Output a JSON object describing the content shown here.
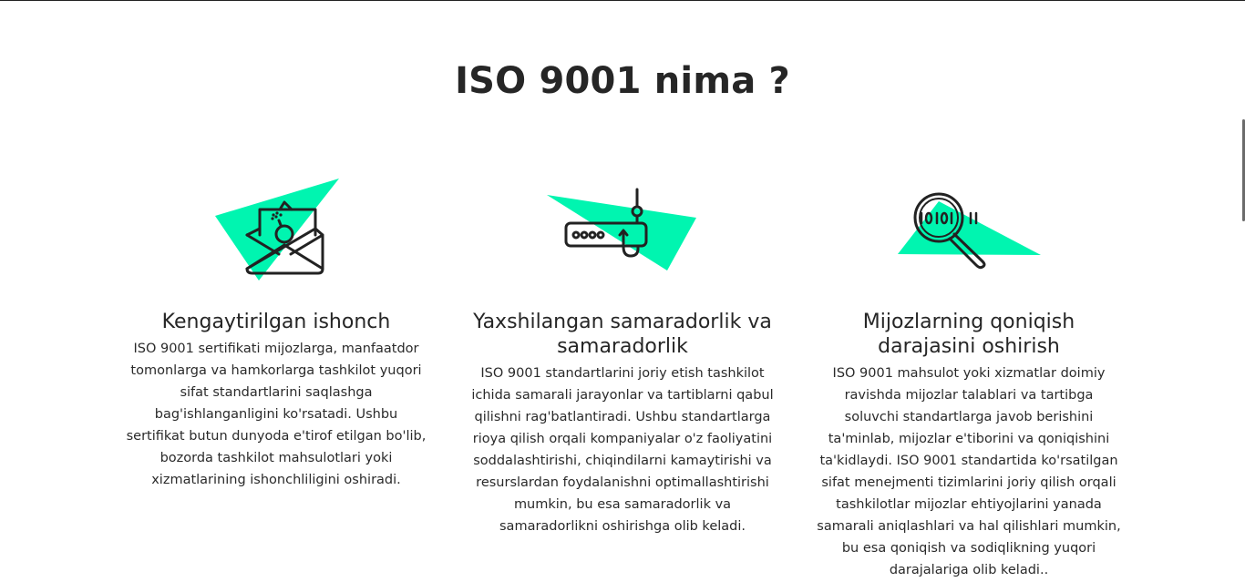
{
  "section": {
    "title": "ISO 9001 nima ?"
  },
  "colors": {
    "accent": "#00f5b0",
    "ink": "#222222"
  },
  "cards": [
    {
      "icon": "envelope-bomb-icon",
      "title": "Kengaytirilgan ishonch",
      "text": "ISO 9001 sertifikati mijozlarga, manfaatdor tomonlarga va hamkorlarga tashkilot yuqori sifat standartlarini saqlashga bag'ishlanganligini ko'rsatadi. Ushbu sertifikat butun dunyoda e'tirof etilgan bo'lib, bozorda tashkilot mahsulotlari yoki xizmatlarining ishonchliligini oshiradi."
    },
    {
      "icon": "router-icon",
      "title": "Yaxshilangan samaradorlik va samaradorlik",
      "text": "ISO 9001 standartlarini joriy etish tashkilot ichida samarali jarayonlar va tartiblarni qabul qilishni rag'batlantiradi. Ushbu standartlarga rioya qilish orqali kompaniyalar o'z faoliyatini soddalashtirishi, chiqindilarni kamaytirishi va resurslardan foydalanishni optimallashtirishi mumkin, bu esa samaradorlik va samaradorlikni oshirishga olib keladi."
    },
    {
      "icon": "magnifier-binary-icon",
      "title": "Mijozlarning qoniqish darajasini oshirish",
      "text": "ISO 9001 mahsulot yoki xizmatlar doimiy ravishda mijozlar talablari va tartibga soluvchi standartlarga javob berishini ta'minlab, mijozlar e'tiborini va qoniqishini ta'kidlaydi. ISO 9001 standartida ko'rsatilgan sifat menejmenti tizimlarini joriy qilish orqali tashkilotlar mijozlar ehtiyojlarini yanada samarali aniqlashlari va hal qilishlari mumkin, bu esa qoniqish va sodiqlikning yuqori darajalariga olib keladi.."
    }
  ]
}
